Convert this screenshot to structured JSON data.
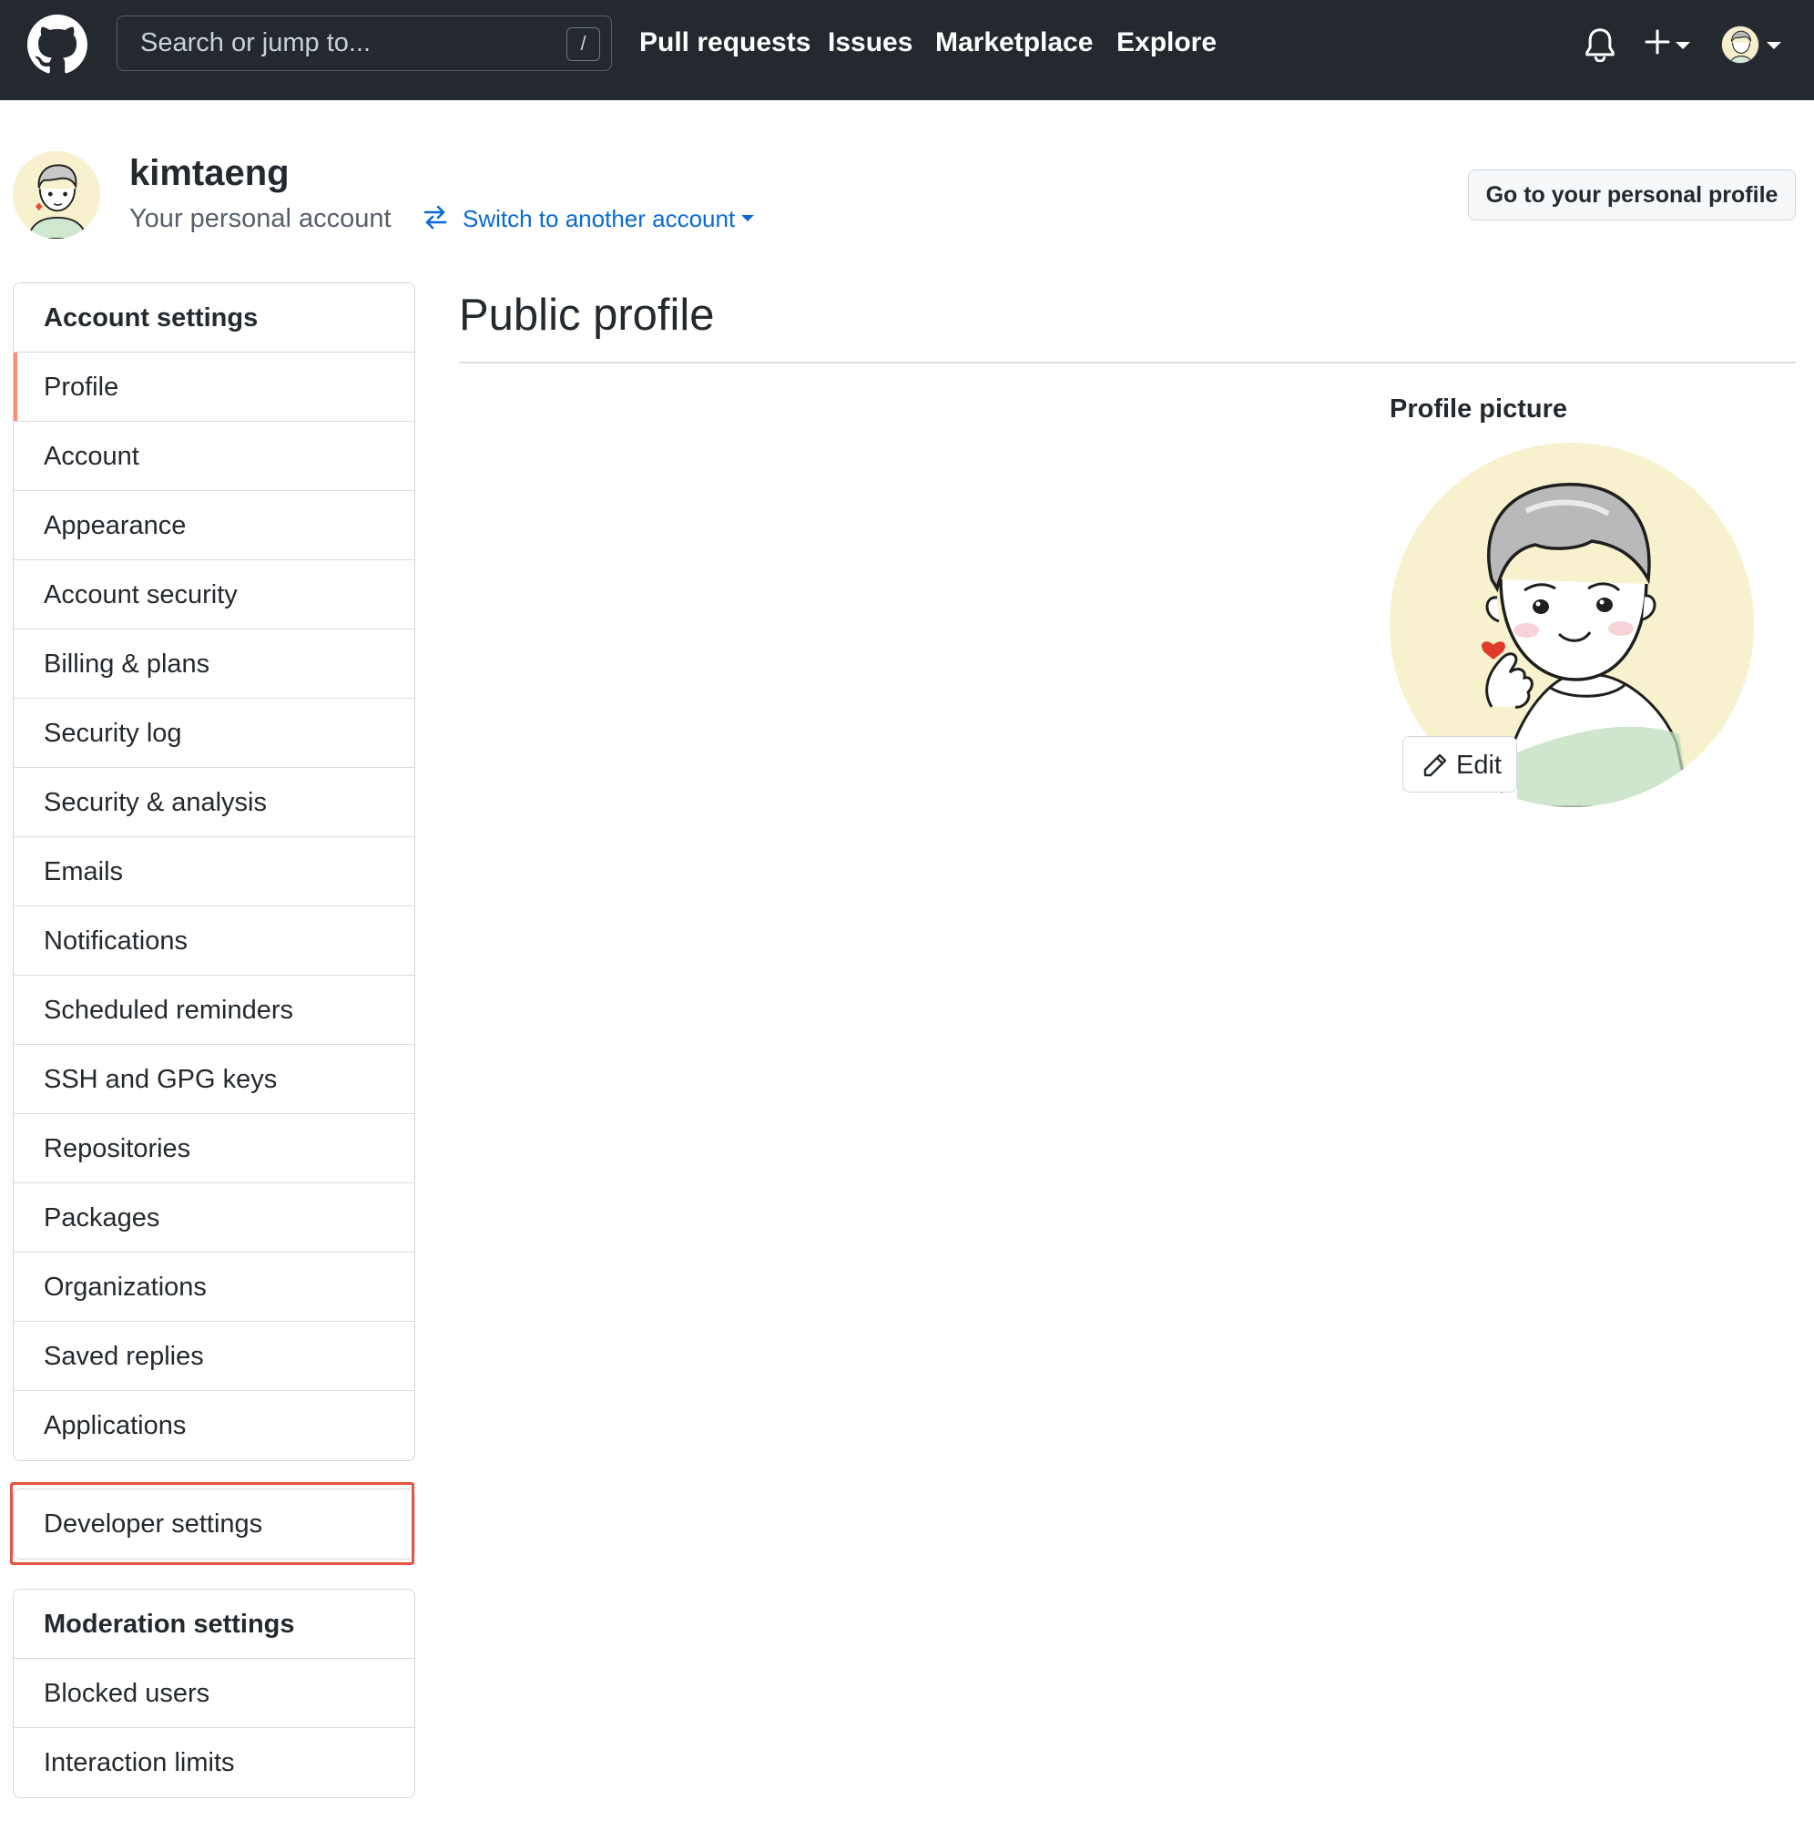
{
  "header": {
    "logo_icon": "github-mark-icon",
    "search_placeholder": "Search or jump to...",
    "search_shortcut": "/",
    "nav": [
      {
        "label": "Pull requests"
      },
      {
        "label": "Issues"
      },
      {
        "label": "Marketplace"
      },
      {
        "label": "Explore"
      }
    ],
    "icons": [
      "bell-icon",
      "plus-icon",
      "caret-down-icon",
      "avatar"
    ]
  },
  "account": {
    "username": "kimtaeng",
    "subtitle": "Your personal account",
    "switch_label": "Switch to another account",
    "profile_button": "Go to your personal profile"
  },
  "sidebar": {
    "account_heading": "Account settings",
    "items": [
      {
        "label": "Profile",
        "selected": true
      },
      {
        "label": "Account"
      },
      {
        "label": "Appearance"
      },
      {
        "label": "Account security"
      },
      {
        "label": "Billing & plans"
      },
      {
        "label": "Security log"
      },
      {
        "label": "Security & analysis"
      },
      {
        "label": "Emails"
      },
      {
        "label": "Notifications"
      },
      {
        "label": "Scheduled reminders"
      },
      {
        "label": "SSH and GPG keys"
      },
      {
        "label": "Repositories"
      },
      {
        "label": "Packages"
      },
      {
        "label": "Organizations"
      },
      {
        "label": "Saved replies"
      },
      {
        "label": "Applications"
      }
    ],
    "developer_settings": "Developer settings",
    "moderation_heading": "Moderation settings",
    "moderation_items": [
      {
        "label": "Blocked users"
      },
      {
        "label": "Interaction limits"
      }
    ]
  },
  "main": {
    "title": "Public profile",
    "picture_heading": "Profile picture",
    "edit_label": "Edit"
  },
  "colors": {
    "header_bg": "#24292f",
    "link": "#0969da",
    "selected_marker": "#fd8c73",
    "highlight_box": "#e5553f",
    "avatar_bg": "#f8f1ce"
  }
}
